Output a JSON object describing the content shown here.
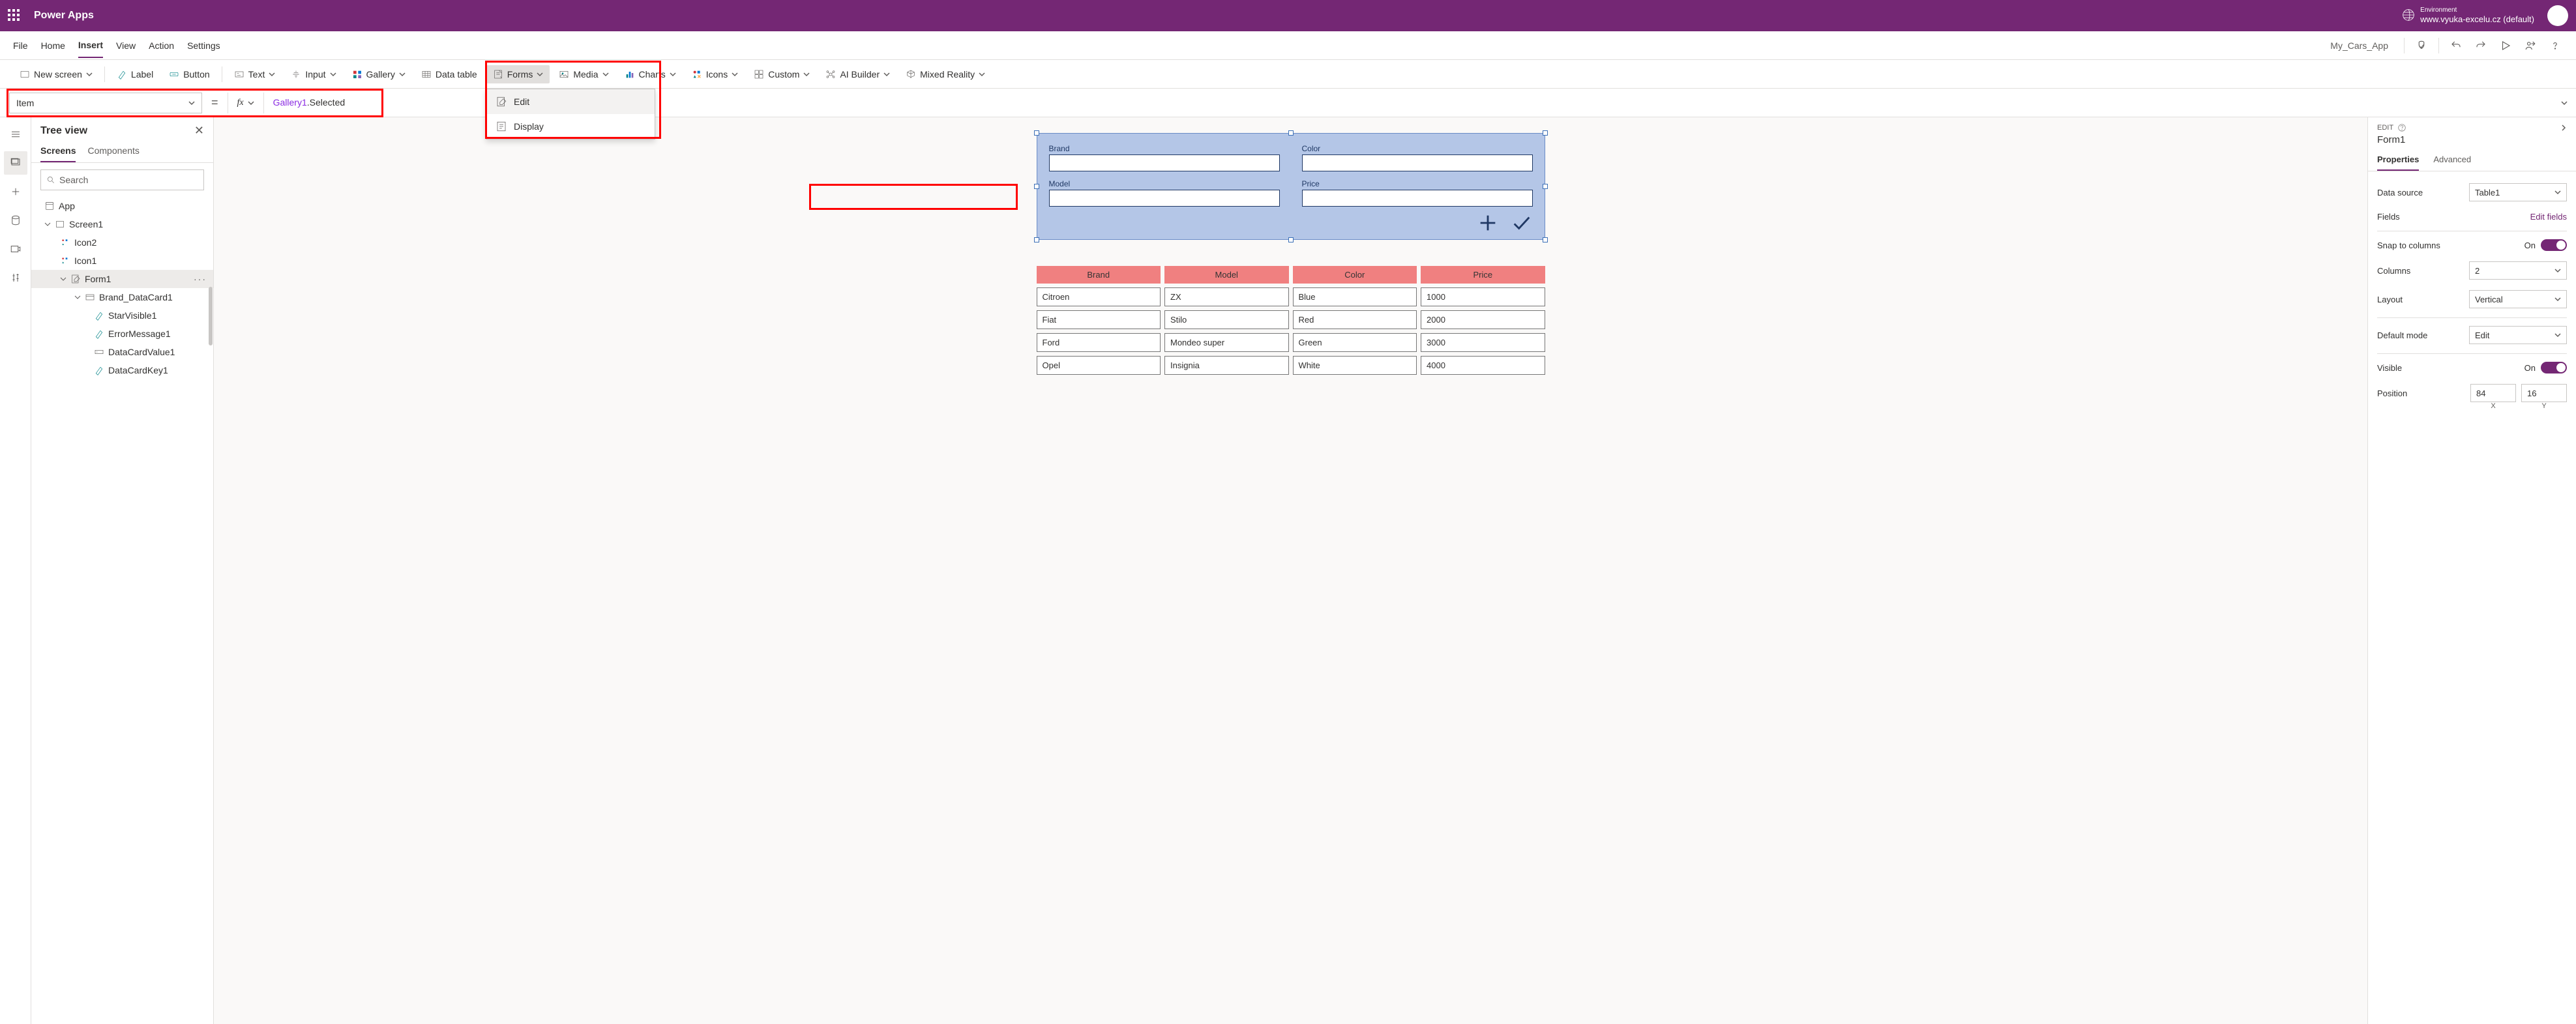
{
  "topbar": {
    "title": "Power Apps",
    "env_label": "Environment",
    "env_name": "www.vyuka-excelu.cz (default)"
  },
  "menu": {
    "items": [
      "File",
      "Home",
      "Insert",
      "View",
      "Action",
      "Settings"
    ],
    "active_index": 2,
    "app_name": "My_Cars_App"
  },
  "ribbon": {
    "new_screen": "New screen",
    "label": "Label",
    "button": "Button",
    "text": "Text",
    "input": "Input",
    "gallery": "Gallery",
    "data_table": "Data table",
    "forms": "Forms",
    "media": "Media",
    "charts": "Charts",
    "icons": "Icons",
    "custom": "Custom",
    "ai_builder": "AI Builder",
    "mixed_reality": "Mixed Reality"
  },
  "forms_dropdown": {
    "edit": "Edit",
    "display": "Display"
  },
  "formula": {
    "property": "Item",
    "fx": "fx",
    "expr_ident": "Gallery1",
    "expr_rest": ".Selected"
  },
  "tree": {
    "title": "Tree view",
    "tabs": [
      "Screens",
      "Components"
    ],
    "active_tab": 0,
    "search_placeholder": "Search",
    "nodes": {
      "app": "App",
      "screen": "Screen1",
      "icon2": "Icon2",
      "icon1": "Icon1",
      "form1": "Form1",
      "brand_card": "Brand_DataCard1",
      "star": "StarVisible1",
      "err": "ErrorMessage1",
      "val": "DataCardValue1",
      "key": "DataCardKey1"
    }
  },
  "canvas": {
    "form_fields": {
      "brand": "Brand",
      "model": "Model",
      "color": "Color",
      "price": "Price"
    },
    "table": {
      "headers": [
        "Brand",
        "Model",
        "Color",
        "Price"
      ],
      "rows": [
        [
          "Citroen",
          "ZX",
          "Blue",
          "1000"
        ],
        [
          "Fiat",
          "Stilo",
          "Red",
          "2000"
        ],
        [
          "Ford",
          "Mondeo super",
          "Green",
          "3000"
        ],
        [
          "Opel",
          "Insignia",
          "White",
          "4000"
        ]
      ]
    }
  },
  "props": {
    "section": "EDIT",
    "name": "Form1",
    "tabs": [
      "Properties",
      "Advanced"
    ],
    "active_tab": 0,
    "data_source_label": "Data source",
    "data_source_value": "Table1",
    "fields_label": "Fields",
    "edit_fields": "Edit fields",
    "snap_label": "Snap to columns",
    "on": "On",
    "columns_label": "Columns",
    "columns_value": "2",
    "layout_label": "Layout",
    "layout_value": "Vertical",
    "default_mode_label": "Default mode",
    "default_mode_value": "Edit",
    "visible_label": "Visible",
    "position_label": "Position",
    "pos_x": "84",
    "pos_y": "16",
    "x": "X",
    "y": "Y"
  }
}
